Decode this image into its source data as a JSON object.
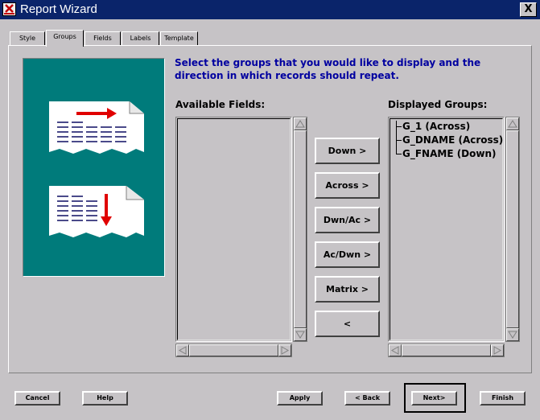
{
  "window": {
    "title": "Report Wizard",
    "close_label": "X"
  },
  "tabs": [
    {
      "label": "Style"
    },
    {
      "label": "Groups"
    },
    {
      "label": "Fields"
    },
    {
      "label": "Labels"
    },
    {
      "label": "Template"
    }
  ],
  "active_tab": "Groups",
  "instruction": "Select the groups that you would like to display and the direction in which records should repeat.",
  "available_fields": {
    "label": "Available Fields:",
    "items": []
  },
  "displayed_groups": {
    "label": "Displayed Groups:",
    "items": [
      {
        "label": "G_1 (Across)"
      },
      {
        "label": "G_DNAME (Across)"
      },
      {
        "label": "G_FNAME (Down)"
      }
    ]
  },
  "move_buttons": {
    "down": "Down  >",
    "across": "Across >",
    "dwn_ac": "Dwn/Ac >",
    "ac_dwn": "Ac/Dwn >",
    "matrix": "Matrix >",
    "remove": "<"
  },
  "footer": {
    "cancel": "Cancel",
    "help": "Help",
    "apply": "Apply",
    "back": "< Back",
    "next": "Next>",
    "finish": "Finish"
  },
  "colors": {
    "title_bar": "#0a246a",
    "instruction_text": "#0000a0",
    "illustration_bg": "#007b7b",
    "arrow": "#e00000",
    "window_bg": "#c6c3c6"
  }
}
